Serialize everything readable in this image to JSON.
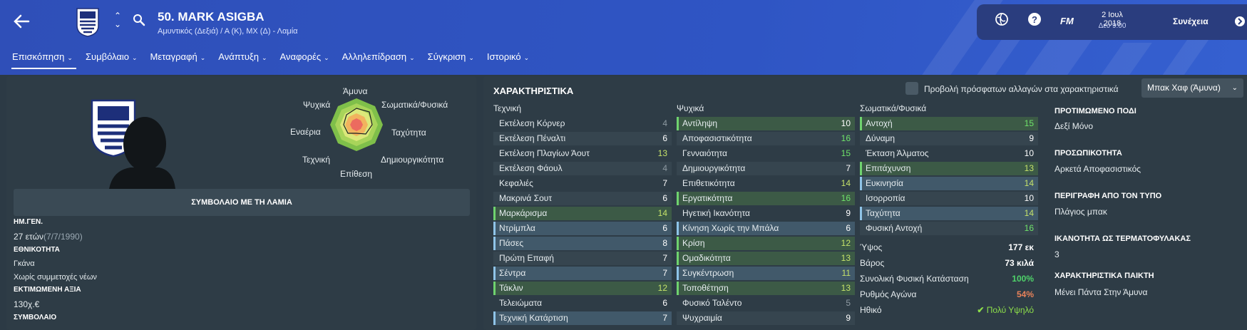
{
  "player": {
    "title": "50. MARK ASIGBA",
    "subtitle": "Αμυντικός (Δεξιά) / Α (Κ), ΜΧ (Δ) - Λαμία"
  },
  "nav": {
    "tabs": [
      {
        "label": "Επισκόπηση",
        "active": true
      },
      {
        "label": "Συμβόλαιο"
      },
      {
        "label": "Μεταγραφή"
      },
      {
        "label": "Ανάπτυξη"
      },
      {
        "label": "Αναφορές"
      },
      {
        "label": "Αλληλεπίδραση"
      },
      {
        "label": "Σύγκριση"
      },
      {
        "label": "Ιστορικό"
      }
    ]
  },
  "topbar": {
    "fm_label": "FM",
    "date": "2 Ιουλ 2018",
    "time": "Δευ 9:00",
    "continue_label": "Συνέχεια"
  },
  "radar": {
    "labels": {
      "top": "Άμυνα",
      "top_right": "Σωματικά/Φυσικά",
      "right": "Ταχύτητα",
      "bottom_right": "Δημιουργικότητα",
      "bottom": "Επίθεση",
      "bottom_left": "Τεχνική",
      "left": "Εναέρια",
      "top_left": "Ψυχικά"
    }
  },
  "profile": {
    "contract_banner": "ΣΥΜΒΟΛΑΙΟ ΜΕ ΤΗ ΛΑΜΙΑ",
    "dob_label": "ΗΜ.ΓΕΝ.",
    "age": "27 ετών",
    "dob": "(7/7/1990)",
    "nationality_label": "ΕΘΝΙΚΟΤΗΤΑ",
    "nationality": "Γκάνα",
    "caps": "Χωρίς συμμετοχές νέων",
    "value_label": "ΕΚΤΙΜΩΜΕΝΗ ΑΞΙΑ",
    "value": "130χ.€",
    "contract_label": "ΣΥΜΒΟΛΑΙΟ"
  },
  "attributes": {
    "title": "ΧΑΡΑΚΤΗΡΙΣΤΙΚΑ",
    "checkbox_label": "Προβολή πρόσφατων αλλαγών στα χαρακτηριστικά",
    "role_dropdown": "Μπακ Χαφ (Άμυνα)",
    "technical_header": "Τεχνική",
    "mental_header": "Ψυχικά",
    "physical_header": "Σωματικά/Φυσικά",
    "technical": [
      {
        "name": "Εκτέλεση Κόρνερ",
        "value": "4",
        "hl": "",
        "c": "c-grey"
      },
      {
        "name": "Εκτέλεση Πέναλτι",
        "value": "6",
        "hl": "",
        "c": "c-white"
      },
      {
        "name": "Εκτέλεση Πλαγίων Άουτ",
        "value": "13",
        "hl": "",
        "c": "c-lime"
      },
      {
        "name": "Εκτέλεση Φάουλ",
        "value": "4",
        "hl": "",
        "c": "c-grey"
      },
      {
        "name": "Κεφαλιές",
        "value": "7",
        "hl": "",
        "c": "c-white"
      },
      {
        "name": "Μακρινά Σουτ",
        "value": "6",
        "hl": "",
        "c": "c-white"
      },
      {
        "name": "Μαρκάρισμα",
        "value": "14",
        "hl": "hl-green",
        "c": "c-lime"
      },
      {
        "name": "Ντρίμπλα",
        "value": "6",
        "hl": "hl-blue",
        "c": "c-white"
      },
      {
        "name": "Πάσες",
        "value": "8",
        "hl": "hl-blue",
        "c": "c-white"
      },
      {
        "name": "Πρώτη Επαφή",
        "value": "7",
        "hl": "",
        "c": "c-white"
      },
      {
        "name": "Σέντρα",
        "value": "7",
        "hl": "hl-blue",
        "c": "c-white"
      },
      {
        "name": "Τάκλιν",
        "value": "12",
        "hl": "hl-green",
        "c": "c-lime"
      },
      {
        "name": "Τελειώματα",
        "value": "6",
        "hl": "",
        "c": "c-white"
      },
      {
        "name": "Τεχνική Κατάρτιση",
        "value": "7",
        "hl": "hl-blue",
        "c": "c-white"
      }
    ],
    "mental": [
      {
        "name": "Αντίληψη",
        "value": "10",
        "hl": "hl-green",
        "c": "c-white"
      },
      {
        "name": "Αποφασιστικότητα",
        "value": "16",
        "hl": "",
        "c": "c-green"
      },
      {
        "name": "Γενναιότητα",
        "value": "15",
        "hl": "",
        "c": "c-green"
      },
      {
        "name": "Δημιουργικότητα",
        "value": "7",
        "hl": "",
        "c": "c-white"
      },
      {
        "name": "Επιθετικότητα",
        "value": "14",
        "hl": "",
        "c": "c-lime"
      },
      {
        "name": "Εργατικότητα",
        "value": "16",
        "hl": "hl-green",
        "c": "c-green"
      },
      {
        "name": "Ηγετική Ικανότητα",
        "value": "9",
        "hl": "",
        "c": "c-white"
      },
      {
        "name": "Κίνηση Χωρίς την Μπάλα",
        "value": "6",
        "hl": "hl-blue",
        "c": "c-white"
      },
      {
        "name": "Κρίση",
        "value": "12",
        "hl": "hl-green",
        "c": "c-lime"
      },
      {
        "name": "Ομαδικότητα",
        "value": "13",
        "hl": "hl-green",
        "c": "c-lime"
      },
      {
        "name": "Συγκέντρωση",
        "value": "11",
        "hl": "hl-blue",
        "c": "c-lime"
      },
      {
        "name": "Τοποθέτηση",
        "value": "13",
        "hl": "hl-green",
        "c": "c-lime"
      },
      {
        "name": "Φυσικό Ταλέντο",
        "value": "5",
        "hl": "",
        "c": "c-grey"
      },
      {
        "name": "Ψυχραιμία",
        "value": "9",
        "hl": "",
        "c": "c-white"
      }
    ],
    "physical": [
      {
        "name": "Αντοχή",
        "value": "15",
        "hl": "hl-green",
        "c": "c-green"
      },
      {
        "name": "Δύναμη",
        "value": "9",
        "hl": "",
        "c": "c-white"
      },
      {
        "name": "Έκταση Άλματος",
        "value": "10",
        "hl": "",
        "c": "c-white"
      },
      {
        "name": "Επιτάχυνση",
        "value": "13",
        "hl": "hl-green",
        "c": "c-lime"
      },
      {
        "name": "Ευκινησία",
        "value": "14",
        "hl": "hl-blue",
        "c": "c-lime"
      },
      {
        "name": "Ισορροπία",
        "value": "10",
        "hl": "",
        "c": "c-white"
      },
      {
        "name": "Ταχύτητα",
        "value": "14",
        "hl": "hl-blue",
        "c": "c-lime"
      },
      {
        "name": "Φυσική Αντοχή",
        "value": "16",
        "hl": "",
        "c": "c-green"
      }
    ],
    "stats": [
      {
        "name": "Ύψος",
        "value": "177 εκ",
        "color": "#ffffff"
      },
      {
        "name": "Βάρος",
        "value": "73 κιλά",
        "color": "#ffffff"
      },
      {
        "name": "Συνολική Φυσική Κατάσταση",
        "value": "100%",
        "color": "#4fd36a"
      },
      {
        "name": "Ρυθμός Αγώνα",
        "value": "54%",
        "color": "#e8825a"
      },
      {
        "name": "Ηθικό",
        "value": "Πολύ Υψηλό",
        "color": "#8ee04a"
      }
    ]
  },
  "side": {
    "foot_label": "ΠΡΟΤΙΜΩΜΕΝΟ ΠΟΔΙ",
    "foot": "Δεξί Μόνο",
    "personality_label": "ΠΡΟΣΩΠΙΚΟΤΗΤΑ",
    "personality": "Αρκετά Αποφασιστικός",
    "media_label": "ΠΕΡΙΓΡΑΦΗ ΑΠΟ ΤΟΝ ΤΥΠΟ",
    "media": "Πλάγιος μπακ",
    "gk_label": "ΙΚΑΝΟΤΗΤΑ ΩΣ ΤΕΡΜΑΤΟΦΥΛΑΚΑΣ",
    "gk": "3",
    "traits_label": "ΧΑΡΑΚΤΗΡΙΣΤΙΚΑ ΠΑΙΚΤΗ",
    "traits": "Μένει Πάντα Στην Άμυνα"
  }
}
